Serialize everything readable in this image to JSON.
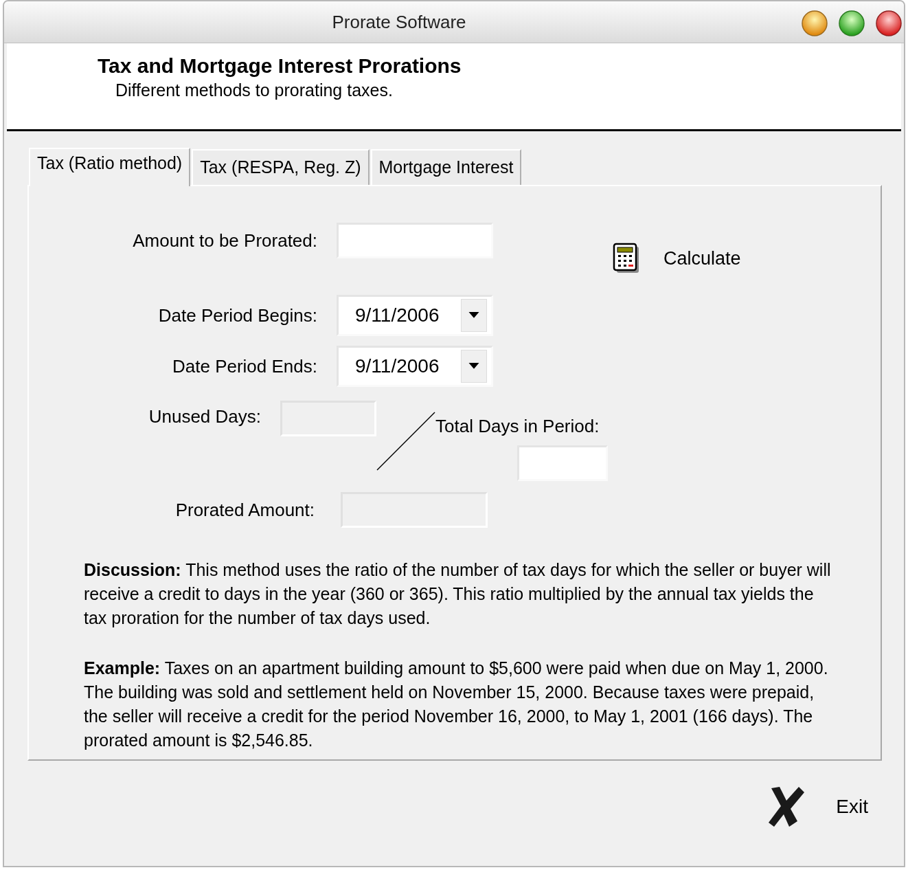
{
  "window": {
    "title": "Prorate Software"
  },
  "header": {
    "title": "Tax and Mortgage Interest Prorations",
    "subtitle": "Different methods to prorating taxes."
  },
  "tabs": [
    {
      "label": "Tax (Ratio method)",
      "selected": true
    },
    {
      "label": "Tax (RESPA, Reg. Z)",
      "selected": false
    },
    {
      "label": "Mortgage Interest",
      "selected": false
    }
  ],
  "amount": {
    "label": "Amount to be Prorated:",
    "disabled": false
  },
  "date_begins": {
    "label": "Date Period Begins:",
    "value": "9/11/2006"
  },
  "date_ends": {
    "label": "Date Period Ends:",
    "value": "9/11/2006"
  },
  "unused_days": {
    "label": "Unused Days:",
    "disabled": true
  },
  "total_days": {
    "label": "Total Days in Period:",
    "disabled": false
  },
  "prorated_amount": {
    "label": "Prorated Amount:",
    "disabled": true
  },
  "calculate_button": {
    "label": "Calculate"
  },
  "discussion": "**Discussion:**  This method uses the ratio of the number of tax days for which the seller or buyer will receive a credit to days in the year (360 or 365). This ratio multiplied by the annual tax yields the tax proration for the number of tax days used.",
  "example": "**Example:**    Taxes on an apartment building amount to $5,600 were paid when due on May 1, 2000.  The building was sold and settlement held on November 15, 2000.  Because taxes were prepaid, the seller will receive a credit for the period November 16, 2000, to May 1, 2001 (166 days).  The prorated amount is $2,546.85.",
  "exit_button": {
    "label": "Exit"
  }
}
